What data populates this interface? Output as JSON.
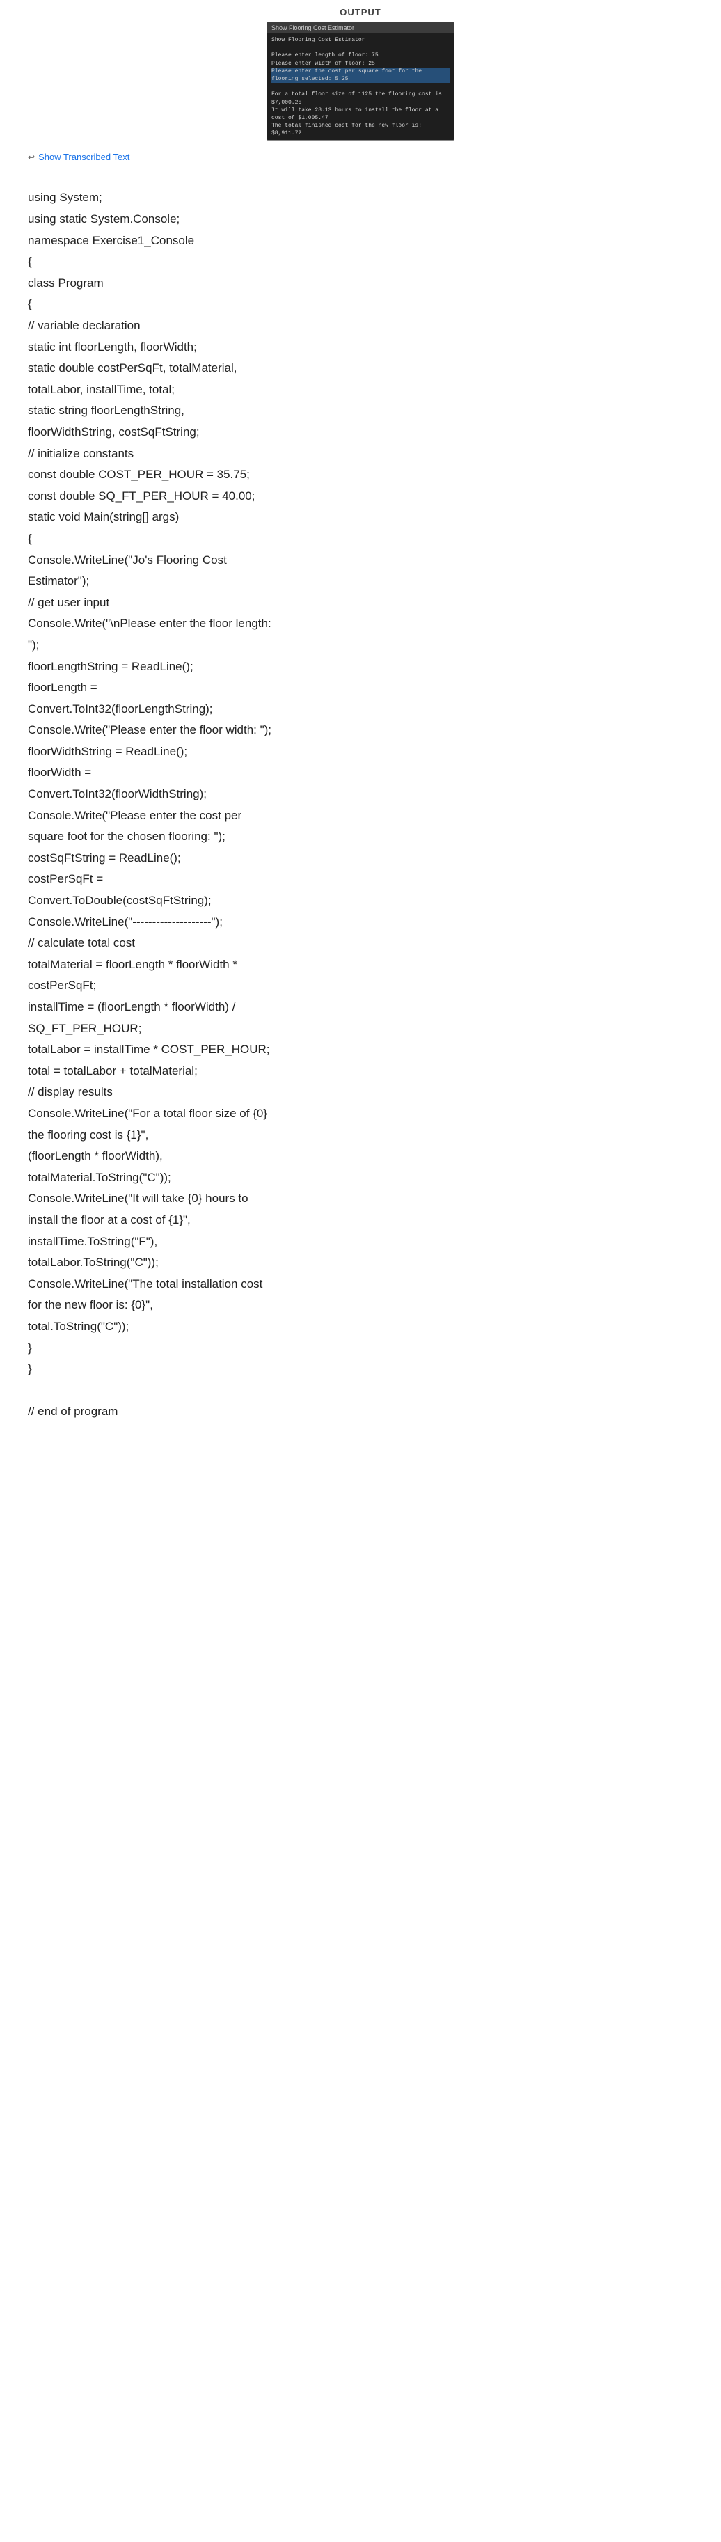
{
  "header": {
    "output_label": "OUTPUT"
  },
  "terminal": {
    "title": "Show Flooring Cost Estimator",
    "lines": [
      "Show Flooring Cost Estimator",
      "",
      "Please enter length of floor: 75",
      "Please enter width of floor: 25",
      "Please enter the cost per square foot for the flooring selected: 5.25",
      "",
      "For a total floor size of 1125 the flooring cost is $7,000.25",
      "It will take 28.13 hours to install the floor at a cost of $1,005.47",
      "The total finished cost for the new floor is: $8,911.72"
    ]
  },
  "show_transcribed": {
    "icon": "↩",
    "label": "Show Transcribed Text"
  },
  "code": {
    "lines": [
      "using System;",
      "using static System.Console;",
      "namespace Exercise1_Console",
      "{",
      "class Program",
      "{",
      "// variable declaration",
      "static int floorLength, floorWidth;",
      "static double costPerSqFt, totalMaterial,",
      "totalLabor, installTime, total;",
      "static string floorLengthString,",
      "floorWidthString, costSqFtString;",
      "// initialize constants",
      "const double COST_PER_HOUR = 35.75;",
      "const double SQ_FT_PER_HOUR = 40.00;",
      "static void Main(string[] args)",
      "{",
      "Console.WriteLine(\"Jo's Flooring Cost",
      "Estimator\");",
      "// get user input",
      "Console.Write(\"\\nPlease enter the floor length:",
      "\");",
      "floorLengthString = ReadLine();",
      "floorLength =",
      "Convert.ToInt32(floorLengthString);",
      "Console.Write(\"Please enter the floor width: \");",
      "floorWidthString = ReadLine();",
      "floorWidth =",
      "Convert.ToInt32(floorWidthString);",
      "Console.Write(\"Please enter the cost per",
      "square foot for the chosen flooring: \");",
      "costSqFtString = ReadLine();",
      "costPerSqFt =",
      "Convert.ToDouble(costSqFtString);",
      "Console.WriteLine(\"--------------------\");",
      "// calculate total cost",
      "totalMaterial = floorLength * floorWidth *",
      "costPerSqFt;",
      "installTime = (floorLength * floorWidth) /",
      "SQ_FT_PER_HOUR;",
      "totalLabor = installTime * COST_PER_HOUR;",
      "total = totalLabor + totalMaterial;",
      "// display results",
      "Console.WriteLine(\"For a total floor size of {0}",
      "the flooring cost is {1}\",",
      "(floorLength * floorWidth),",
      "totalMaterial.ToString(\"C\"));",
      "Console.WriteLine(\"It will take {0} hours to",
      "install the floor at a cost of {1}\",",
      "installTime.ToString(\"F\"),",
      "totalLabor.ToString(\"C\"));",
      "Console.WriteLine(\"The total installation cost",
      "for the new floor is: {0}\",",
      "total.ToString(\"C\"));",
      "}",
      "}",
      "",
      "// end of program"
    ]
  }
}
